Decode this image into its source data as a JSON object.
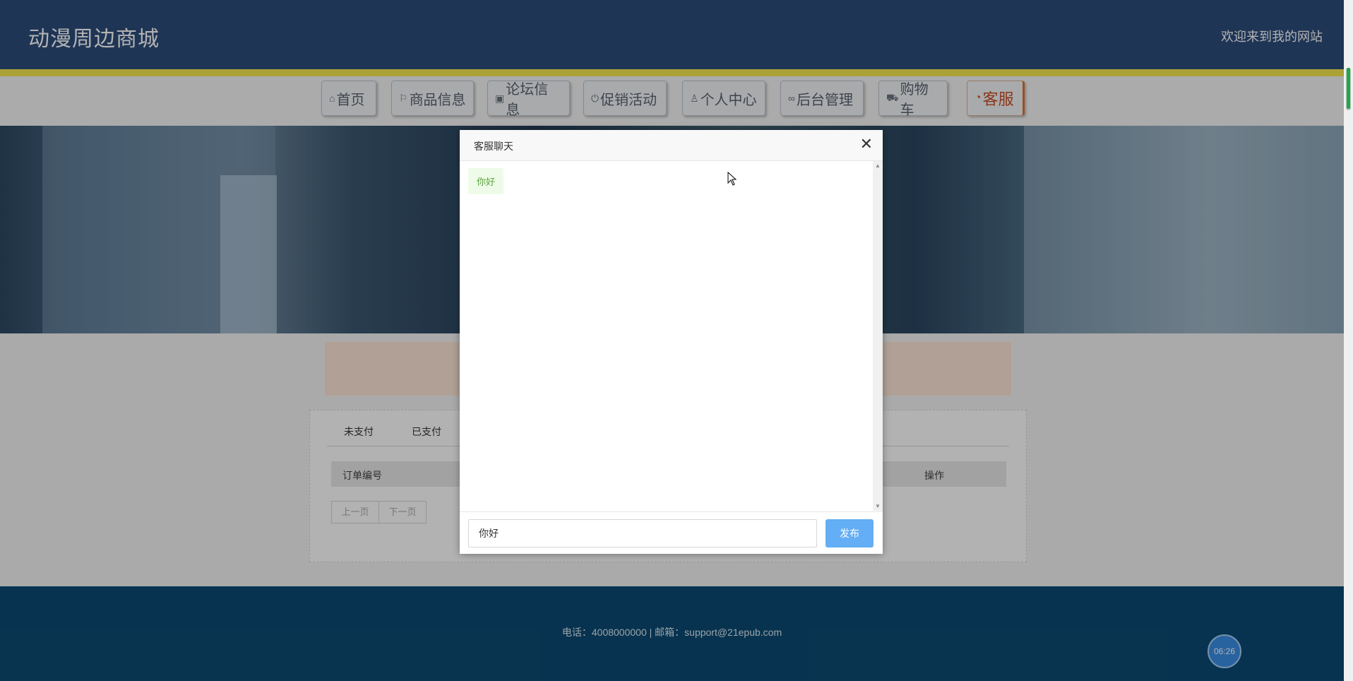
{
  "header": {
    "site_title": "动漫周边商城",
    "welcome_text": "欢迎来到我的网站"
  },
  "nav": {
    "items": [
      {
        "label": "首页",
        "icon": "home-icon"
      },
      {
        "label": "商品信息",
        "icon": "flag-icon"
      },
      {
        "label": "论坛信息",
        "icon": "apps-icon"
      },
      {
        "label": "促销活动",
        "icon": "power-icon"
      },
      {
        "label": "个人中心",
        "icon": "user-icon"
      },
      {
        "label": "后台管理",
        "icon": "link-icon"
      },
      {
        "label": "购物车",
        "icon": "cart-icon"
      },
      {
        "label": "客服",
        "icon": "service-icon"
      }
    ]
  },
  "orders": {
    "tabs": [
      "未支付",
      "已支付"
    ],
    "columns": [
      "订单编号",
      "操作"
    ],
    "pager": {
      "prev_label": "上一页",
      "next_label": "下一页"
    }
  },
  "footer": {
    "contact_text": "电话：4008000000 | 邮箱：support@21epub.com"
  },
  "clock": {
    "time": "06:26"
  },
  "dialog": {
    "title": "客服聊天",
    "close_icon": "close-icon",
    "messages": [
      {
        "text": "你好"
      }
    ],
    "input_value": "你好",
    "send_label": "发布"
  },
  "colors": {
    "header_bg": "#2d4d7c",
    "accent_yellow": "#f5e94c",
    "footer_bg": "#0b4a73",
    "send_button": "#63aef5",
    "service_accent": "#c9502a"
  }
}
